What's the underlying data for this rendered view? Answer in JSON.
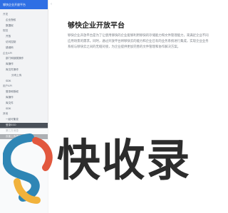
{
  "sidebar": {
    "header": "够快企业开放平台",
    "collapse_icon": "chevron-left-icon",
    "items": [
      {
        "label": "开发",
        "level": "group"
      },
      {
        "label": "企业授权",
        "level": "l1"
      },
      {
        "label": "数据权",
        "level": "l1"
      },
      {
        "label": "规范",
        "level": "group"
      },
      {
        "label": "开放",
        "level": "l1"
      },
      {
        "label": "访问控制",
        "level": "l1"
      },
      {
        "label": "错误码",
        "level": "l1"
      },
      {
        "label": "企业API",
        "level": "group"
      },
      {
        "label": "部门和部属操作",
        "level": "l1"
      },
      {
        "label": "库操作",
        "level": "l1"
      },
      {
        "label": "库文件操作",
        "level": "l1"
      },
      {
        "label": "分块上传",
        "level": "l2"
      },
      {
        "label": "SDK",
        "level": "l1"
      },
      {
        "label": "用户API",
        "level": "group"
      },
      {
        "label": "登录和授权",
        "level": "l1"
      },
      {
        "label": "库操作",
        "level": "l1"
      },
      {
        "label": "库文件",
        "level": "l1"
      },
      {
        "label": "SDK",
        "level": "l1"
      },
      {
        "label": "其他",
        "level": "group"
      },
      {
        "label": "一起可集变",
        "level": "l1"
      },
      {
        "label": "登录SSO",
        "level": "l1",
        "dark": true
      },
      {
        "label": "第三方消息",
        "level": "l1"
      },
      {
        "label": "页面上传插件使用",
        "level": "l1",
        "dark": true
      }
    ]
  },
  "main": {
    "title": "够快企业开放平台",
    "paragraph": "够快企业开放平台是为了让使用够快的企业能够利用够快的存储能力和文件管理能力，来满足企业不同应用场景的需求。同时，通过开放平台将够快云的能力和企业已有的业务系统进行集成，实现企业业务系统与够快云之间的无缝对接，为企业提供更加完善的文件管理和协作解决方案。"
  },
  "watermark": {
    "text": "快收录"
  }
}
